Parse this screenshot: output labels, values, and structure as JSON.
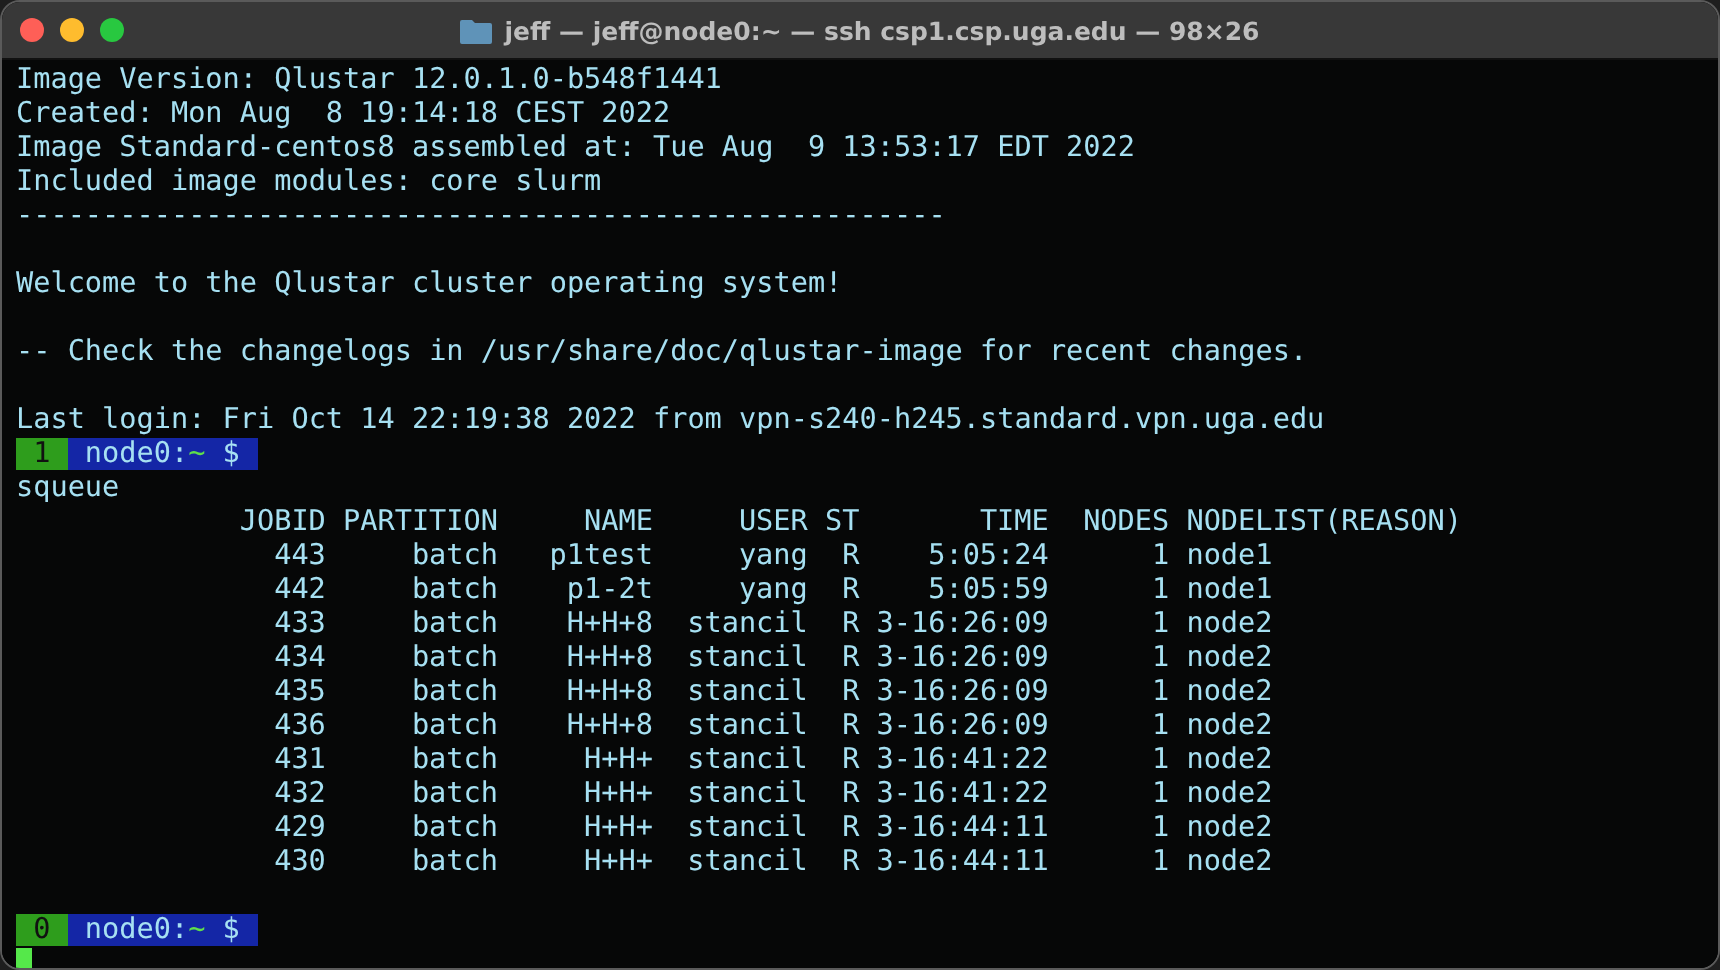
{
  "window": {
    "title": "jeff — jeff@node0:~ — ssh csp1.csp.uga.edu — 98×26"
  },
  "terminal": {
    "lines": [
      {
        "kind": "text",
        "text": "Image Version: Qlustar 12.0.1.0-b548f1441"
      },
      {
        "kind": "text",
        "text": "Created: Mon Aug  8 19:14:18 CEST 2022"
      },
      {
        "kind": "text",
        "text": "Image Standard-centos8 assembled at: Tue Aug  9 13:53:17 EDT 2022"
      },
      {
        "kind": "text",
        "text": "Included image modules: core slurm"
      },
      {
        "kind": "text",
        "text": "------------------------------------------------------"
      },
      {
        "kind": "blank"
      },
      {
        "kind": "text",
        "text": "Welcome to the Qlustar cluster operating system!"
      },
      {
        "kind": "blank"
      },
      {
        "kind": "text",
        "text": "-- Check the changelogs in /usr/share/doc/qlustar-image for recent changes."
      },
      {
        "kind": "blank"
      },
      {
        "kind": "text",
        "text": "Last login: Fri Oct 14 22:19:38 2022 from vpn-s240-h245.standard.vpn.uga.edu"
      },
      {
        "kind": "prompt",
        "window": "1",
        "host": "node0:",
        "path": "~",
        "symbol": "$"
      },
      {
        "kind": "text",
        "text": "squeue"
      },
      {
        "kind": "table",
        "columns": [
          "JOBID",
          "PARTITION",
          "NAME",
          "USER",
          "ST",
          "TIME",
          "NODES",
          "NODELIST(REASON)"
        ],
        "rows": [
          [
            "443",
            "batch",
            "p1test",
            "yang",
            "R",
            "5:05:24",
            "1",
            "node1"
          ],
          [
            "442",
            "batch",
            "p1-2t",
            "yang",
            "R",
            "5:05:59",
            "1",
            "node1"
          ],
          [
            "433",
            "batch",
            "H+H+8",
            "stancil",
            "R",
            "3-16:26:09",
            "1",
            "node2"
          ],
          [
            "434",
            "batch",
            "H+H+8",
            "stancil",
            "R",
            "3-16:26:09",
            "1",
            "node2"
          ],
          [
            "435",
            "batch",
            "H+H+8",
            "stancil",
            "R",
            "3-16:26:09",
            "1",
            "node2"
          ],
          [
            "436",
            "batch",
            "H+H+8",
            "stancil",
            "R",
            "3-16:26:09",
            "1",
            "node2"
          ],
          [
            "431",
            "batch",
            "H+H+",
            "stancil",
            "R",
            "3-16:41:22",
            "1",
            "node2"
          ],
          [
            "432",
            "batch",
            "H+H+",
            "stancil",
            "R",
            "3-16:41:22",
            "1",
            "node2"
          ],
          [
            "429",
            "batch",
            "H+H+",
            "stancil",
            "R",
            "3-16:44:11",
            "1",
            "node2"
          ],
          [
            "430",
            "batch",
            "H+H+",
            "stancil",
            "R",
            "3-16:44:11",
            "1",
            "node2"
          ]
        ]
      },
      {
        "kind": "blank"
      },
      {
        "kind": "prompt",
        "window": "0",
        "host": "node0:",
        "path": "~",
        "symbol": "$"
      },
      {
        "kind": "cursor"
      }
    ]
  }
}
